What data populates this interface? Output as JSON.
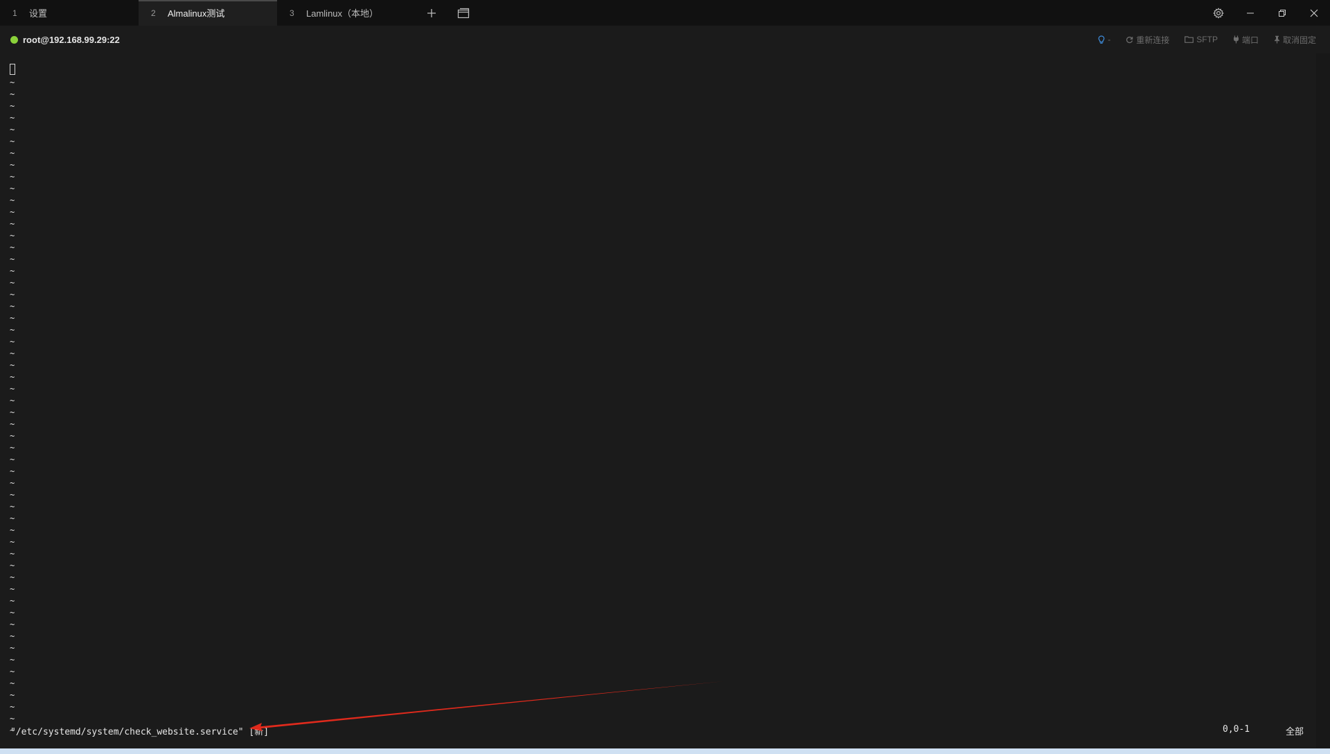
{
  "tabs": [
    {
      "number": "1",
      "label": "设置",
      "active": false
    },
    {
      "number": "2",
      "label": "Almalinux测试",
      "active": true
    },
    {
      "number": "3",
      "label": "Lamlinux（本地）",
      "active": false
    }
  ],
  "tab_actions": {
    "new_tab_icon": "plus-icon",
    "window_icon": "window-stack-icon"
  },
  "window_controls": [
    "gear-icon",
    "minimize-icon",
    "restore-icon",
    "close-icon"
  ],
  "session": {
    "host": "root@192.168.99.29:22",
    "status_color": "#8bd13a"
  },
  "toolbar": {
    "bulb_label": "-",
    "reconnect_label": "重新连接",
    "sftp_label": "SFTP",
    "port_label": "端口",
    "unpin_label": "取消固定"
  },
  "terminal": {
    "empty_line_marker": "~",
    "empty_line_count": 56,
    "status_message": "\"/etc/systemd/system/check_website.service\" [新]",
    "cursor_position": "0,0-1",
    "scroll_position": "全部"
  },
  "annotation": {
    "arrow_color": "#e02a1c"
  }
}
